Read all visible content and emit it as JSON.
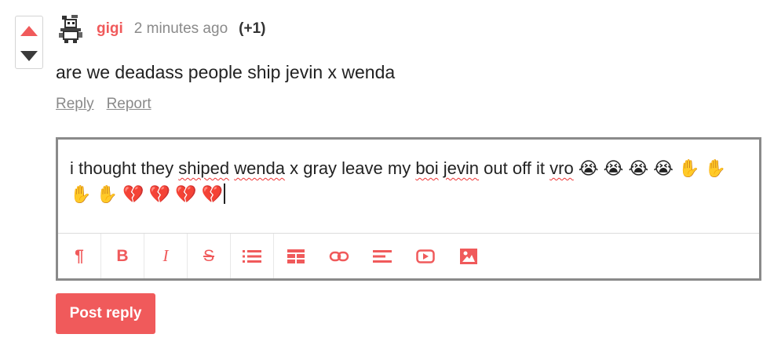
{
  "comment": {
    "username": "gigi",
    "timestamp": "2 minutes ago",
    "score": "(+1)",
    "body": "are we deadass people ship jevin x wenda",
    "reply_label": "Reply",
    "report_label": "Report"
  },
  "reply_editor": {
    "text_segments": [
      {
        "text": "i thought they ",
        "spell": false
      },
      {
        "text": "shiped",
        "spell": true
      },
      {
        "text": " ",
        "spell": false
      },
      {
        "text": "wenda",
        "spell": true
      },
      {
        "text": " x gray leave my ",
        "spell": false
      },
      {
        "text": "boi",
        "spell": true
      },
      {
        "text": " ",
        "spell": false
      },
      {
        "text": "jevin",
        "spell": true
      },
      {
        "text": " out off it  ",
        "spell": false
      },
      {
        "text": "vro",
        "spell": true
      },
      {
        "text": " 😭 😭 😭 😭 ✋ ✋ ✋ ✋ 💔 💔 💔 💔",
        "spell": false
      }
    ],
    "toolbar": [
      {
        "name": "paragraph-icon",
        "glyph": "¶"
      },
      {
        "name": "bold-icon",
        "glyph": "B"
      },
      {
        "name": "italic-icon",
        "glyph": "I"
      },
      {
        "name": "strikethrough-icon",
        "glyph": "S"
      },
      {
        "name": "bullet-list-icon",
        "glyph": ""
      },
      {
        "name": "table-icon",
        "glyph": ""
      },
      {
        "name": "link-icon",
        "glyph": ""
      },
      {
        "name": "align-icon",
        "glyph": ""
      },
      {
        "name": "video-icon",
        "glyph": ""
      },
      {
        "name": "image-icon",
        "glyph": ""
      }
    ]
  },
  "post_button_label": "Post reply",
  "colors": {
    "accent": "#f05a5b",
    "muted": "#8a8a8a",
    "down_arrow": "#3a3a3a"
  }
}
